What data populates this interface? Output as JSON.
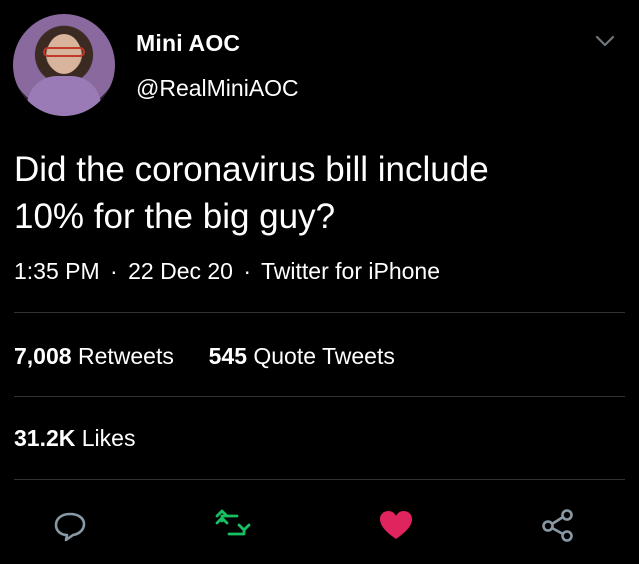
{
  "author": {
    "display_name": "Mini AOC",
    "handle": "@RealMiniAOC"
  },
  "tweet": {
    "text_line1": "Did the coronavirus bill include",
    "text_line2": "10% for the big guy?",
    "time": "1:35 PM",
    "date": "22 Dec 20",
    "source": "Twitter for iPhone",
    "separator": "·"
  },
  "stats": {
    "retweets_count": "7,008",
    "retweets_label": "Retweets",
    "quotes_count": "545",
    "quotes_label": "Quote Tweets",
    "likes_count": "31.2K",
    "likes_label": "Likes"
  },
  "icons": {
    "reply": "speech-bubble-icon",
    "retweet": "retweet-icon",
    "like": "heart-icon",
    "share": "share-icon",
    "menu": "chevron-down-icon"
  },
  "colors": {
    "background": "#000000",
    "text": "#ffffff",
    "retweet_green": "#17bf63",
    "like_pink": "#e0245e",
    "divider": "#2f3336"
  }
}
